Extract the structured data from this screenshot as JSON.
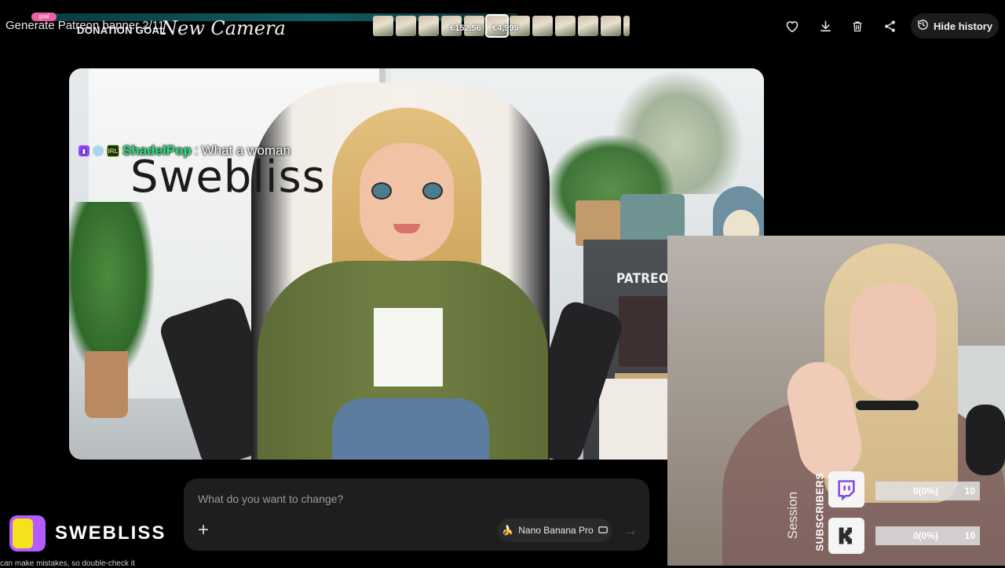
{
  "topbar": {
    "title": "Generate Patreon banner 2/11",
    "donation_label": "DONATION GOAL",
    "donation_pill": "goal",
    "camera_text": "New Camera",
    "amounts": [
      "€152.56",
      "€4,999"
    ],
    "actions": {
      "hide_history": "Hide history"
    }
  },
  "canvas": {
    "signature": "Swebliss",
    "patreon_text": "PATREON.COM/SWEBLISS"
  },
  "chat": {
    "username": "ShadelPop",
    "separator": " : ",
    "message": "What a woman",
    "badge_irl": "IRL"
  },
  "prompt": {
    "placeholder": "What do you want to change?",
    "model": "Nano Banana Pro",
    "model_icon": "banana-icon"
  },
  "brand": {
    "name": "SWEBLISS",
    "disclaimer": "can make mistakes, so double-check it"
  },
  "widget": {
    "session_label": "Session",
    "subscribers_label": "SUBSCRIBERS",
    "rows": [
      {
        "platform": "twitch-icon",
        "value": "0(0%)",
        "goal": "10"
      },
      {
        "platform": "kick-icon",
        "value": "0(0%)",
        "goal": "10"
      }
    ]
  },
  "colors": {
    "chat_user": "#26e27e",
    "twitch": "#9147ff",
    "brand_purple": "#b45cff",
    "brand_yellow": "#f6e21a"
  }
}
